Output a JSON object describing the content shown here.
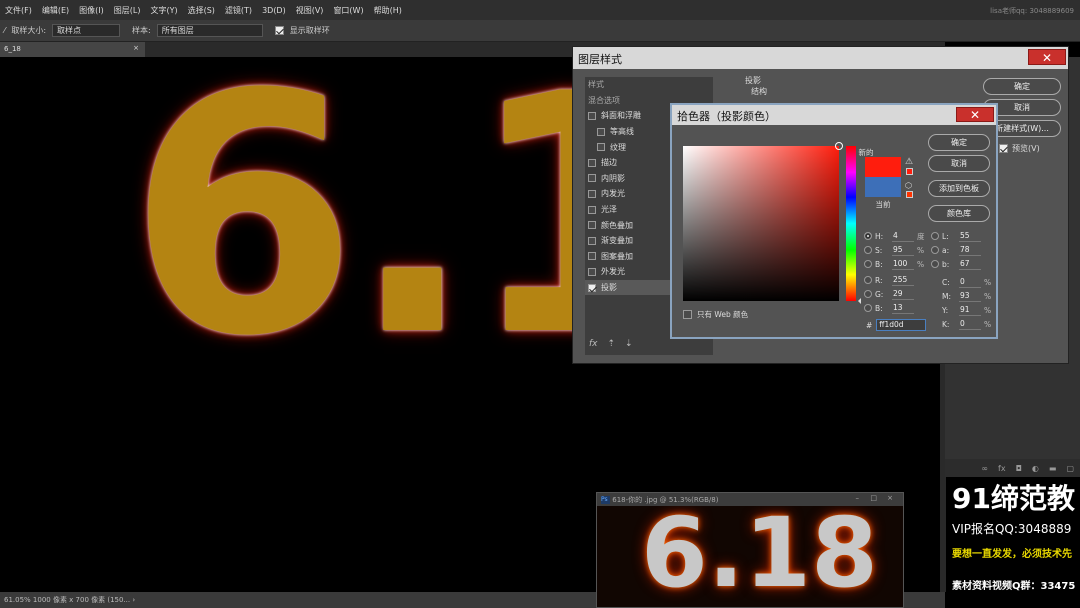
{
  "menubar": {
    "items": [
      "文件(F)",
      "编辑(E)",
      "图像(I)",
      "图层(L)",
      "文字(Y)",
      "选择(S)",
      "滤镜(T)",
      "3D(D)",
      "视图(V)",
      "窗口(W)",
      "帮助(H)"
    ],
    "right_text": "lisa老师qq: 3048889609"
  },
  "options": {
    "sample_size_label": "取样大小:",
    "sample_size_value": "取样点",
    "sample_label": "样本:",
    "sample_value": "所有图层",
    "show_ring_label": "显示取样环"
  },
  "document": {
    "tab_label": "6_18",
    "status": "61.05% 1000 像素 x 700 像素 (150... ›"
  },
  "canvas": {
    "text": "6.18"
  },
  "layer_style": {
    "title": "图层样式",
    "close": "✕",
    "list_header": "样式",
    "blend_options": "混合选项",
    "items": [
      {
        "label": "斜面和浮雕",
        "checked": false,
        "indent": false
      },
      {
        "label": "等高线",
        "checked": false,
        "indent": true
      },
      {
        "label": "纹理",
        "checked": false,
        "indent": true
      },
      {
        "label": "描边",
        "checked": false,
        "indent": false
      },
      {
        "label": "内阴影",
        "checked": false,
        "indent": false
      },
      {
        "label": "内发光",
        "checked": false,
        "indent": false
      },
      {
        "label": "光泽",
        "checked": false,
        "indent": false
      },
      {
        "label": "颜色叠加",
        "checked": false,
        "indent": false
      },
      {
        "label": "渐变叠加",
        "checked": false,
        "indent": false
      },
      {
        "label": "图案叠加",
        "checked": false,
        "indent": false
      },
      {
        "label": "外发光",
        "checked": false,
        "indent": false
      },
      {
        "label": "投影",
        "checked": true,
        "indent": false
      }
    ],
    "section_title": "投影",
    "section_sub": "结构",
    "ok": "确定",
    "cancel": "取消",
    "new_style": "新建样式(W)...",
    "preview": "预览(V)",
    "fx": "fx"
  },
  "color_picker": {
    "title": "拾色器（投影颜色）",
    "close": "✕",
    "ok": "确定",
    "cancel": "取消",
    "add_swatch": "添加到色板",
    "libraries": "颜色库",
    "new_label": "新的",
    "current_label": "当前",
    "web_only": "只有 Web 颜色",
    "new_color": "#ff1d0d",
    "current_color": "#3d6fb8",
    "hsb": [
      {
        "l": "H:",
        "v": "4",
        "u": "度",
        "on": true
      },
      {
        "l": "S:",
        "v": "95",
        "u": "%",
        "on": false
      },
      {
        "l": "B:",
        "v": "100",
        "u": "%",
        "on": false
      }
    ],
    "rgb": [
      {
        "l": "R:",
        "v": "255"
      },
      {
        "l": "G:",
        "v": "29"
      },
      {
        "l": "B:",
        "v": "13"
      }
    ],
    "lab": [
      {
        "l": "L:",
        "v": "55"
      },
      {
        "l": "a:",
        "v": "78"
      },
      {
        "l": "b:",
        "v": "67"
      }
    ],
    "cmyk": [
      {
        "l": "C:",
        "v": "0"
      },
      {
        "l": "M:",
        "v": "93"
      },
      {
        "l": "Y:",
        "v": "91"
      },
      {
        "l": "K:",
        "v": "0"
      }
    ],
    "hex_label": "#",
    "hex": "ff1d0d"
  },
  "thumbnail": {
    "title": "618-你的 .jpg @ 51.3%(RGB/8)",
    "text": "6.18"
  },
  "promo": {
    "line1": "91缔范教",
    "line2": "VIP报名QQ:3048889",
    "line3": "要想一直发发，必须技术先",
    "line4": "素材资料视频Q群：33475"
  }
}
